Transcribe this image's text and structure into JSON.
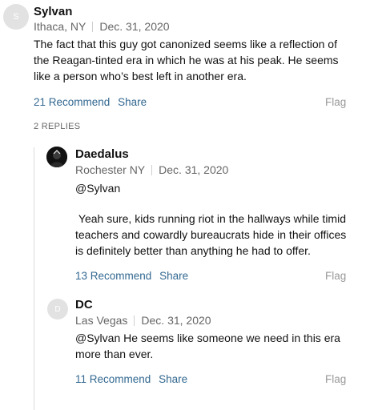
{
  "comments": [
    {
      "avatar_initial": "S",
      "author": "Sylvan",
      "location": "Ithaca, NY",
      "date": "Dec. 31, 2020",
      "text": "The fact that this guy got canonized seems like a reflection of the Reagan-tinted era in which he was at his peak. He seems like a person who’s best left in another era.",
      "recommend_label": "21 Recommend",
      "share_label": "Share",
      "flag_label": "Flag"
    }
  ],
  "replies_label": "2 REPLIES",
  "replies": [
    {
      "avatar_icon": "user-photo-icon",
      "author": "Daedalus",
      "location": "Rochester NY",
      "date": "Dec. 31, 2020",
      "text_line1": "@Sylvan",
      "text_line2": " Yeah sure, kids running riot in the hallways while timid teachers and cowardly bureaucrats hide in their offices is definitely better than anything he had to offer.",
      "recommend_label": "13 Recommend",
      "share_label": "Share",
      "flag_label": "Flag"
    },
    {
      "avatar_initial": "D",
      "author": "DC",
      "location": "Las Vegas",
      "date": "Dec. 31, 2020",
      "text": "@Sylvan He seems like someone we need in this era more than ever.",
      "recommend_label": "11 Recommend",
      "share_label": "Share",
      "flag_label": "Flag"
    }
  ],
  "colors": {
    "link": "#326891",
    "meta": "#666666",
    "flag": "#999999",
    "avatar_bg": "#e2e2e2"
  }
}
